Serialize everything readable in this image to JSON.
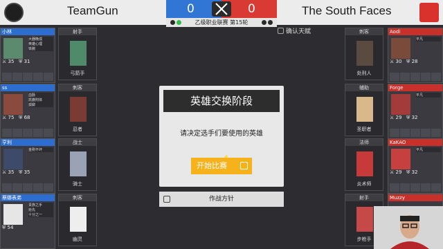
{
  "teams": {
    "left": {
      "name": "TeamGun",
      "score": "0"
    },
    "right": {
      "name": "The South Faces",
      "score": "0"
    }
  },
  "league_label": "乙级职业联赛 第15轮",
  "confirm_label": "确认天赋",
  "left_players": [
    {
      "name": "小林",
      "stats": [
        "35",
        "31"
      ],
      "info": [
        "大器晚成",
        "英雄心理",
        "铁腕"
      ]
    },
    {
      "name": "ss",
      "stats": [
        "75",
        "68"
      ],
      "info": [
        "血脉",
        "凯撒附体",
        "孤僻"
      ]
    },
    {
      "name": "亨利",
      "stats": [
        "35",
        "35"
      ],
      "info": [
        "金刚不坏"
      ]
    },
    {
      "name": "蔡娜表弟",
      "stats": [
        "54"
      ],
      "info": [
        "贵族之手",
        "抢先",
        "十分之一"
      ]
    }
  ],
  "left_roles": [
    {
      "role": "射手",
      "hero": "弓箭手"
    },
    {
      "role": "刺客",
      "hero": "忍者"
    },
    {
      "role": "战士",
      "hero": "骑士"
    },
    {
      "role": "刺客",
      "hero": "幽灵"
    }
  ],
  "right_players": [
    {
      "name": "Aodi",
      "stats": [
        "30",
        "28"
      ],
      "info": [
        "平凡"
      ]
    },
    {
      "name": "Forge",
      "stats": [
        "29",
        "32"
      ],
      "info": [
        "平凡"
      ]
    },
    {
      "name": "KaKAO",
      "stats": [
        "29",
        "32"
      ],
      "info": [
        "平凡"
      ]
    },
    {
      "name": "Muzzy",
      "stats": [],
      "info": [
        "平凡"
      ]
    }
  ],
  "right_roles": [
    {
      "role": "刺客",
      "hero": "处刑人"
    },
    {
      "role": "辅助",
      "hero": "圣职者"
    },
    {
      "role": "法师",
      "hero": "炎术师"
    },
    {
      "role": "射手",
      "hero": "步枪手"
    }
  ],
  "modal": {
    "title": "英雄交换阶段",
    "text": "请决定选手们要使用的英雄",
    "start_button": "开始比赛"
  },
  "strategy_label": "作战方针",
  "colors": {
    "blue": "#3176d4",
    "red": "#d93a34",
    "start": "#f5b21a"
  }
}
